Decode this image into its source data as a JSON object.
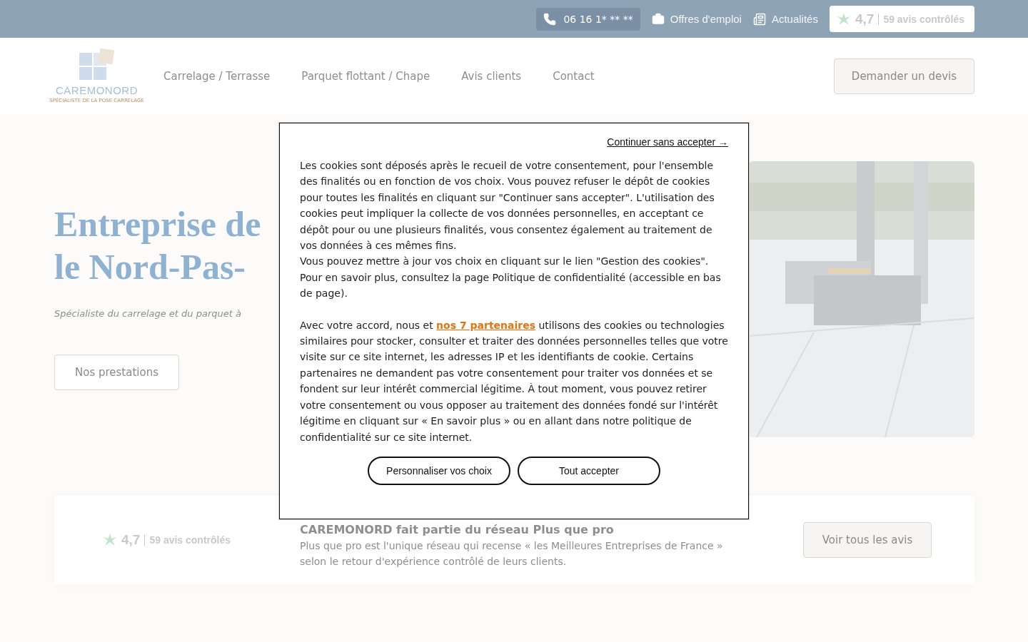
{
  "top_bar": {
    "phone": "06 16 1* ** **",
    "links": [
      {
        "kind": "jobs",
        "label": "Offres d'emploi"
      },
      {
        "kind": "news",
        "label": "Actualités"
      }
    ],
    "rating": {
      "score": "4,7",
      "count": "59 avis contrôlés"
    }
  },
  "header": {
    "logo": {
      "name": "CAREMONORD",
      "tagline": "SPÉCIALISTE DE LA POSE CARRELAGE"
    },
    "nav": [
      {
        "label": "Carrelage / Terrasse"
      },
      {
        "label": "Parquet flottant / Chape"
      },
      {
        "label": "Avis clients"
      },
      {
        "label": "Contact"
      }
    ],
    "cta": "Demander un devis"
  },
  "hero": {
    "title_lines": [
      "Entreprise de",
      "le Nord-Pas-"
    ],
    "subtitle": "Spécialiste du carrelage et du parquet à",
    "button": "Nos prestations",
    "image": {
      "kind": "picture"
    }
  },
  "reviews_card": {
    "rating": {
      "score": "4,7",
      "count": "59 avis contrôlés"
    },
    "heading": "CAREMONORD fait partie du réseau Plus que pro",
    "text": "Plus que pro est l'unique réseau qui recense « les Meilleures Entreprises de France » selon le retour d'expérience contrôlé de leurs clients.",
    "button": "Voir tous les avis"
  },
  "cookie_dialog": {
    "skip_link": "Continuer sans accepter →",
    "paragraphs": [
      {
        "text": "Les cookies sont déposés après le recueil de votre consentement, pour l'ensemble des finalités ou en fonction de vos choix. Vous pouvez refuser le dépôt de cookies pour toutes les finalités en cliquant sur \"Continuer sans accepter\". L'utilisation des cookies peut impliquer la collecte de vos données personnelles, en acceptant ce dépôt pour ou une plusieurs finalités, vous consentez également au traitement de vos données à ces mêmes fins."
      },
      {
        "text": "Vous pouvez mettre à jour vos choix en cliquant sur le lien \"Gestion des cookies\". Pour en savoir plus, consultez la page Politique de confidentialité (accessible en bas de page)."
      },
      {
        "text": "Avec votre accord, nous et ",
        "link": "nos 7 partenaires",
        "after": " utilisons des cookies ou technologies similaires pour stocker, consulter et traiter des données personnelles telles que votre visite sur ce site internet, les adresses IP et les identifiants de cookie. Certains partenaires ne demandent pas votre consentement pour traiter vos données et se fondent sur leur intérêt commercial légitime. À tout moment, vous pouvez retirer votre consentement ou vous opposer au traitement des données fondé sur l'intérêt légitime en cliquant sur « En savoir plus » ou en allant dans notre politique de confidentialité sur ce site internet."
      }
    ],
    "buttons": [
      "Personnaliser vos choix",
      "Tout accepter"
    ]
  }
}
